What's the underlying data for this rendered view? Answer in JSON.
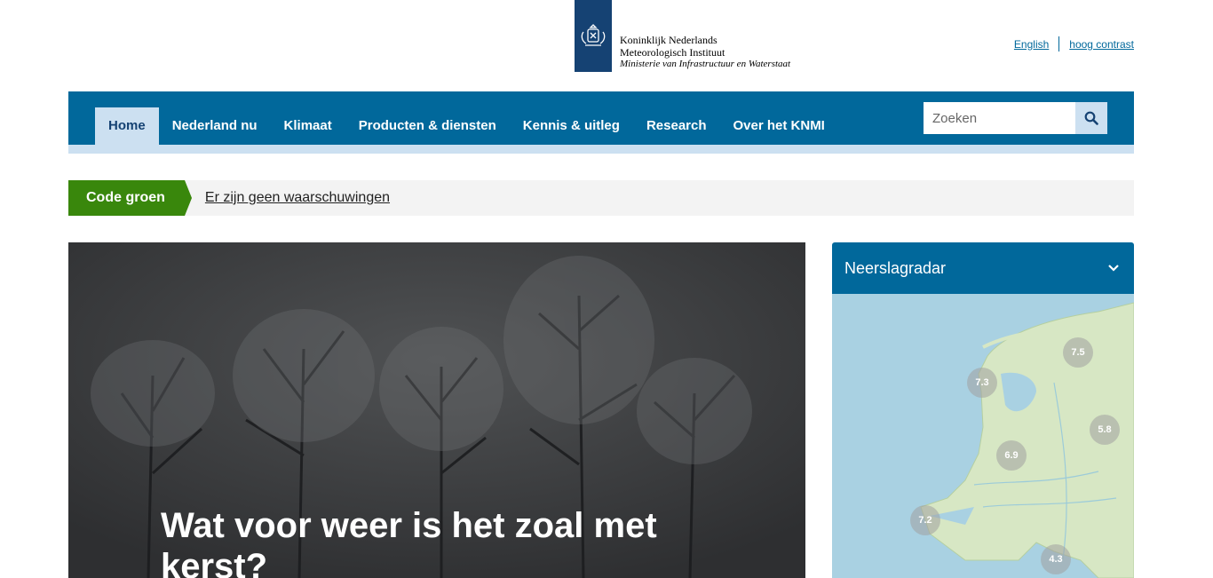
{
  "header": {
    "logo_line1": "Koninklijk Nederlands",
    "logo_line2": "Meteorologisch Instituut",
    "logo_line3": "Ministerie van Infrastructuur en Waterstaat",
    "links": {
      "english": "English",
      "contrast": "hoog contrast"
    }
  },
  "nav": {
    "items": [
      "Home",
      "Nederland nu",
      "Klimaat",
      "Producten & diensten",
      "Kennis & uitleg",
      "Research",
      "Over het KNMI"
    ],
    "active": "Home",
    "search_placeholder": "Zoeken"
  },
  "warning": {
    "code": "Code groen",
    "message": "Er zijn geen waarschuwingen"
  },
  "hero": {
    "title": "Wat voor weer is het zoal met kerst?"
  },
  "radar": {
    "title": "Neerslagradar",
    "temperatures": [
      "7.5",
      "7.3",
      "5.8",
      "6.9",
      "7.2",
      "4.3"
    ]
  },
  "colors": {
    "brand_blue": "#01689b",
    "nav_light": "#cce0f1",
    "code_green": "#39870c",
    "logo_blue": "#154273"
  }
}
